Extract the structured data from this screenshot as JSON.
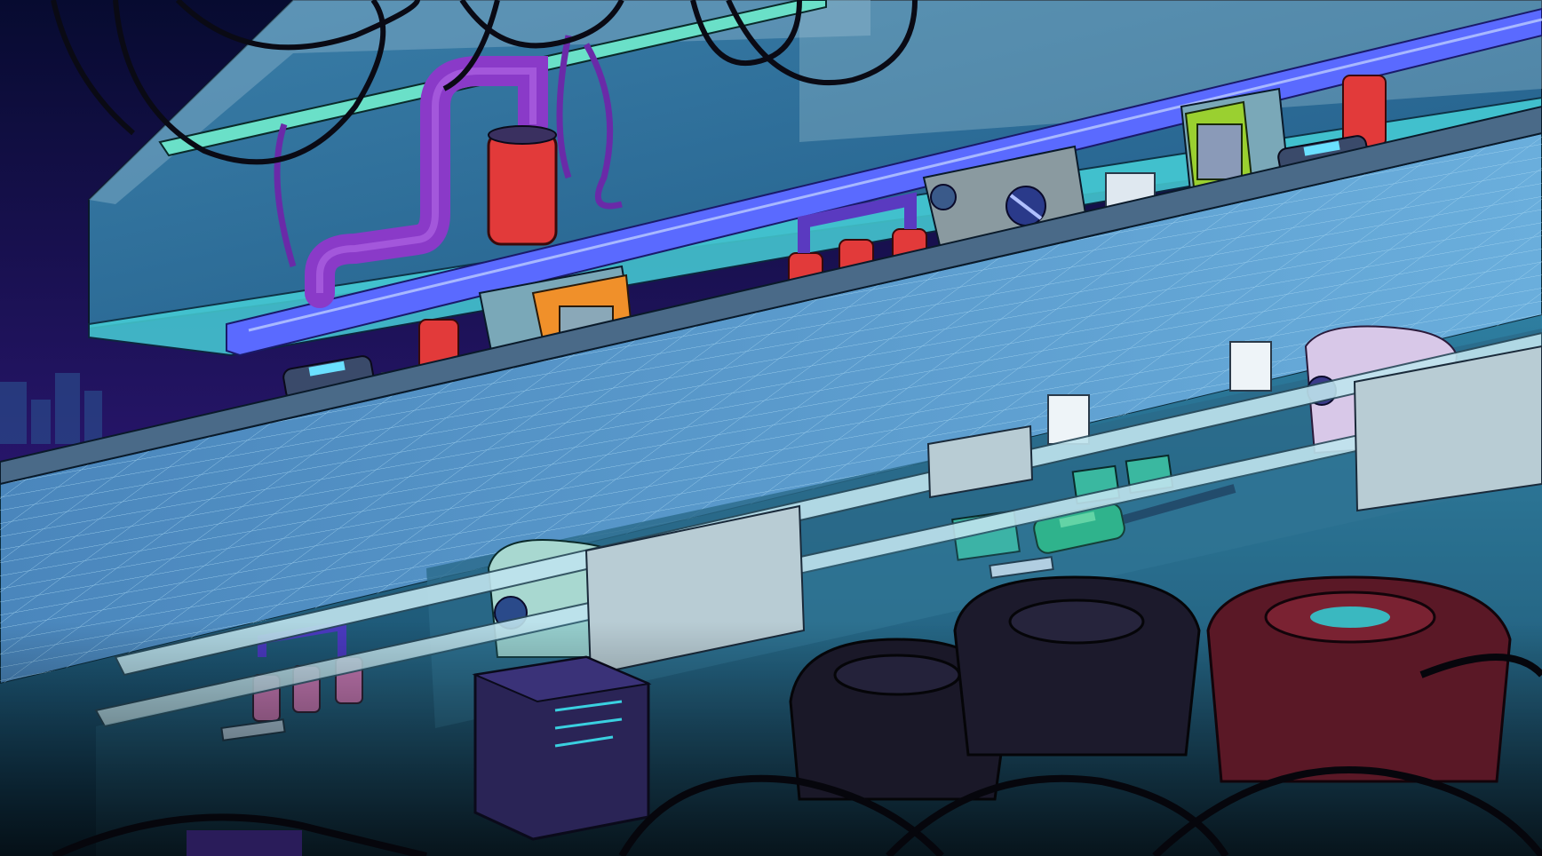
{
  "scene": {
    "palette": {
      "night_sky": "#0a0f3a",
      "sky_purple": "#4a1a8a",
      "glass_cyan": "#3fb8c8",
      "glass_deep": "#1c6a8a",
      "floor_blue": "#4a8ec4",
      "floor_line": "#9fd0f0",
      "wall_grey": "#8fa8b8",
      "neon_purple_pipe": "#8a3ac8",
      "neon_blue_rail": "#4a5aff",
      "red_tank": "#e23a3a",
      "pink_tank": "#e070b0",
      "orange_machine": "#f0902a",
      "lime_machine": "#9ad030",
      "teal_machine": "#3ab8a0",
      "dark_pod": "#2a2040",
      "red_pod": "#6a1a2a",
      "cable_black": "#0a0a14"
    },
    "icons": [
      "hanging-cable-icon",
      "red-fluid-tank-icon",
      "pink-fluid-tank-icon",
      "orange-console-icon",
      "lime-console-icon",
      "teal-canister-icon",
      "wall-panel-icon",
      "domed-pod-icon"
    ]
  }
}
